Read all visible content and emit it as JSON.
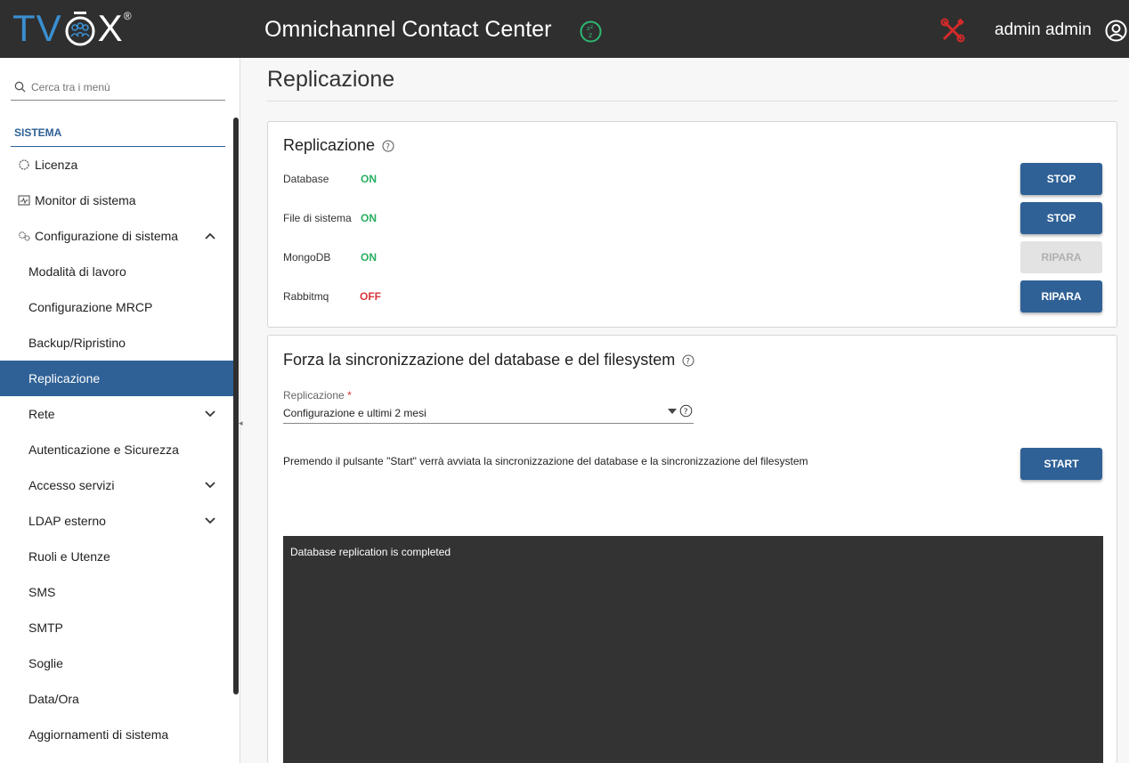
{
  "header": {
    "logo_text": "TVOX",
    "app_title": "Omnichannel Contact Center",
    "user_name": "admin admin",
    "icons": [
      "sleep-status-icon",
      "tools-icon",
      "user-icon"
    ]
  },
  "sidebar": {
    "search_placeholder": "Cerca tra i menù",
    "section": "SISTEMA",
    "items": [
      {
        "label": "Licenza",
        "icon": "gear-icon",
        "level": "top"
      },
      {
        "label": "Monitor di sistema",
        "icon": "monitor-icon",
        "level": "top"
      },
      {
        "label": "Configurazione di sistema",
        "icon": "gears-icon",
        "level": "top",
        "expanded": true
      },
      {
        "label": "Modalità di lavoro",
        "level": "sub"
      },
      {
        "label": "Configurazione MRCP",
        "level": "sub"
      },
      {
        "label": "Backup/Ripristino",
        "level": "sub"
      },
      {
        "label": "Replicazione",
        "level": "sub",
        "active": true
      },
      {
        "label": "Rete",
        "level": "sub",
        "collapsible": true
      },
      {
        "label": "Autenticazione e Sicurezza",
        "level": "sub"
      },
      {
        "label": "Accesso servizi",
        "level": "sub",
        "collapsible": true
      },
      {
        "label": "LDAP esterno",
        "level": "sub",
        "collapsible": true
      },
      {
        "label": "Ruoli e Utenze",
        "level": "sub"
      },
      {
        "label": "SMS",
        "level": "sub"
      },
      {
        "label": "SMTP",
        "level": "sub"
      },
      {
        "label": "Soglie",
        "level": "sub"
      },
      {
        "label": "Data/Ora",
        "level": "sub"
      },
      {
        "label": "Aggiornamenti di sistema",
        "level": "sub"
      }
    ]
  },
  "page": {
    "title": "Replicazione"
  },
  "replication_card": {
    "title": "Replicazione",
    "rows": [
      {
        "label": "Database",
        "status": "ON",
        "button": "STOP",
        "button_enabled": true
      },
      {
        "label": "File di sistema",
        "status": "ON",
        "button": "STOP",
        "button_enabled": true
      },
      {
        "label": "MongoDB",
        "status": "ON",
        "button": "RIPARA",
        "button_enabled": false
      },
      {
        "label": "Rabbitmq",
        "status": "OFF",
        "button": "RIPARA",
        "button_enabled": true
      }
    ]
  },
  "sync_card": {
    "title": "Forza la sincronizzazione del database e del filesystem",
    "field_label": "Replicazione",
    "field_required_mark": "*",
    "field_value": "Configurazione e ultimi 2 mesi",
    "info_text": "Premendo il pulsante \"Start\" verrà avviata la sincronizzazione del database e la sincronizzazione del filesystem",
    "start_label": "START",
    "console_output": "Database replication is completed"
  },
  "colors": {
    "topbar": "#2f2f2f",
    "accent": "#2f6196",
    "status_on": "#27ae60",
    "status_off": "#d9363e",
    "logo_blue": "#3a8fd0",
    "tools_red": "#d42a2a",
    "sleep_green": "#2eb872"
  }
}
